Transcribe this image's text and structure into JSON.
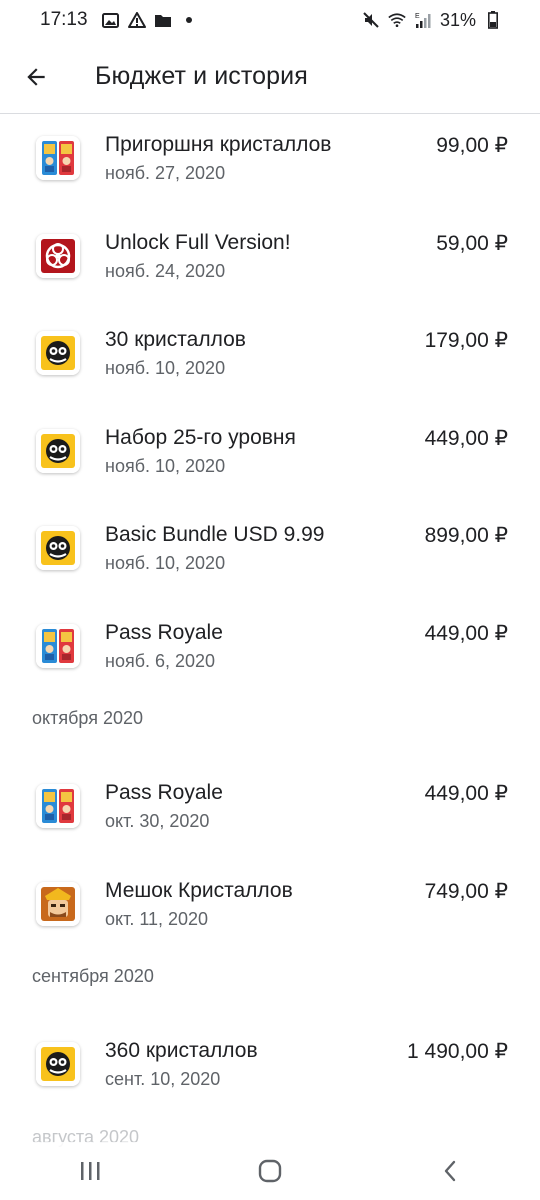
{
  "status_bar": {
    "time": "17:13",
    "battery": "31%"
  },
  "app_bar": {
    "title": "Бюджет и история"
  },
  "purchases_top": [
    {
      "title": "Пригоршня кристаллов",
      "date": "нояб. 27, 2020",
      "price": "99,00 ₽",
      "icon": "clash-royale-icon"
    },
    {
      "title": "Unlock Full Version!",
      "date": "нояб. 24, 2020",
      "price": "59,00 ₽",
      "icon": "plague-inc-icon"
    },
    {
      "title": "30 кристаллов",
      "date": "нояб. 10, 2020",
      "price": "179,00 ₽",
      "icon": "brawl-stars-icon"
    },
    {
      "title": "Набор 25-го уровня",
      "date": "нояб. 10, 2020",
      "price": "449,00 ₽",
      "icon": "brawl-stars-icon"
    },
    {
      "title": "Basic Bundle USD 9.99",
      "date": "нояб. 10, 2020",
      "price": "899,00 ₽",
      "icon": "brawl-stars-icon"
    },
    {
      "title": "Pass Royale",
      "date": "нояб. 6, 2020",
      "price": "449,00 ₽",
      "icon": "clash-royale-icon"
    }
  ],
  "section_october": {
    "label": "октября 2020",
    "items": [
      {
        "title": "Pass Royale",
        "date": "окт. 30, 2020",
        "price": "449,00 ₽",
        "icon": "clash-royale-icon"
      },
      {
        "title": "Мешок Кристаллов",
        "date": "окт. 11, 2020",
        "price": "749,00 ₽",
        "icon": "clash-of-clans-icon"
      }
    ]
  },
  "section_september": {
    "label": "сентября 2020",
    "items": [
      {
        "title": "360 кристаллов",
        "date": "сент. 10, 2020",
        "price": "1 490,00 ₽",
        "icon": "brawl-stars-icon"
      }
    ]
  },
  "section_august": {
    "label": "августа 2020"
  },
  "colors": {
    "text_primary": "#202124",
    "text_secondary": "#5f6368",
    "divider": "#dadce0"
  }
}
